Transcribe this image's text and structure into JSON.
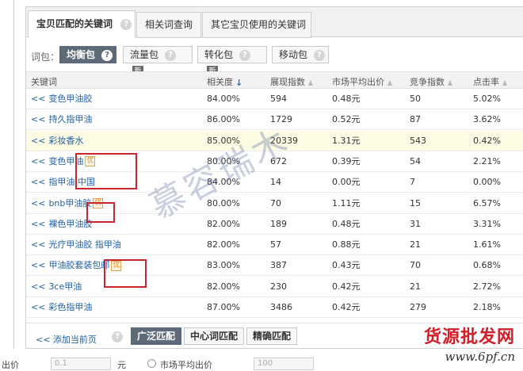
{
  "tabs": [
    {
      "label": "宝贝匹配的关键词",
      "active": true
    },
    {
      "label": "相关词查询",
      "active": false
    },
    {
      "label": "其它宝贝使用的关键词",
      "active": false
    }
  ],
  "help_glyph": "?",
  "packages": {
    "label": "词包：",
    "items": [
      {
        "label": "均衡包",
        "active": true
      },
      {
        "label": "流量包",
        "new": "新"
      },
      {
        "label": "转化包",
        "new": "新"
      },
      {
        "label": "移动包"
      }
    ]
  },
  "table": {
    "headers": [
      "关键词",
      "相关度",
      "展现指数",
      "市场平均出价",
      "竞争指数",
      "点击率"
    ],
    "sort_arrow": "↓",
    "add_arrow": "<<",
    "you_badge": "优",
    "rows": [
      {
        "keyword": "变色甲油胶",
        "relevance": "84.00%",
        "impressions": "594",
        "avg_bid": "0.48元",
        "competition": "50",
        "ctr": "5.02%"
      },
      {
        "keyword": "持久指甲油",
        "relevance": "86.00%",
        "impressions": "1729",
        "avg_bid": "0.52元",
        "competition": "87",
        "ctr": "3.62%"
      },
      {
        "keyword": "彩妆香水",
        "relevance": "85.00%",
        "impressions": "20339",
        "avg_bid": "1.31元",
        "competition": "543",
        "ctr": "0.42%",
        "highlight": true
      },
      {
        "keyword": "变色甲油",
        "relevance": "80.00%",
        "impressions": "672",
        "avg_bid": "0.39元",
        "competition": "54",
        "ctr": "2.21%",
        "you": true
      },
      {
        "keyword": "指甲油 中国",
        "relevance": "84.00%",
        "impressions": "14",
        "avg_bid": "0.00元",
        "competition": "7",
        "ctr": "0.00%"
      },
      {
        "keyword": "bnb甲油胶",
        "relevance": "80.00%",
        "impressions": "70",
        "avg_bid": "1.11元",
        "competition": "15",
        "ctr": "6.57%",
        "you": true
      },
      {
        "keyword": "裸色甲油胶",
        "relevance": "82.00%",
        "impressions": "189",
        "avg_bid": "0.48元",
        "competition": "31",
        "ctr": "3.31%"
      },
      {
        "keyword": "光疗甲油胶 指甲油",
        "relevance": "82.00%",
        "impressions": "57",
        "avg_bid": "0.88元",
        "competition": "21",
        "ctr": "1.61%"
      },
      {
        "keyword": "甲油胶套装包邮",
        "relevance": "83.00%",
        "impressions": "387",
        "avg_bid": "0.43元",
        "competition": "70",
        "ctr": "0.68%",
        "you": true
      },
      {
        "keyword": "3ce甲油",
        "relevance": "82.00%",
        "impressions": "230",
        "avg_bid": "0.42元",
        "competition": "21",
        "ctr": "2.72%"
      },
      {
        "keyword": "彩色指甲油",
        "relevance": "87.00%",
        "impressions": "3486",
        "avg_bid": "0.42元",
        "competition": "279",
        "ctr": "2.18%"
      }
    ]
  },
  "footer": {
    "add_current_page": "<< 添加当前页",
    "match_buttons": [
      {
        "label": "广泛匹配",
        "active": true
      },
      {
        "label": "中心词匹配",
        "active": false
      },
      {
        "label": "精确匹配",
        "active": false
      }
    ]
  },
  "bottom": {
    "label_left": "出价",
    "input1_value": "0.1",
    "unit": "元",
    "radio_label": "市场平均出价",
    "input2_value": "100"
  },
  "watermark": "慕容瑞木",
  "brand": {
    "cn": "货源批发网",
    "url": "www.6pf.cn"
  },
  "colors": {
    "link": "#1f5fa8",
    "active_button": "#5d6b78",
    "highlight_row": "#fdfbe4",
    "annotation_red": "#c8262a",
    "brand_red": "#d21e28"
  }
}
